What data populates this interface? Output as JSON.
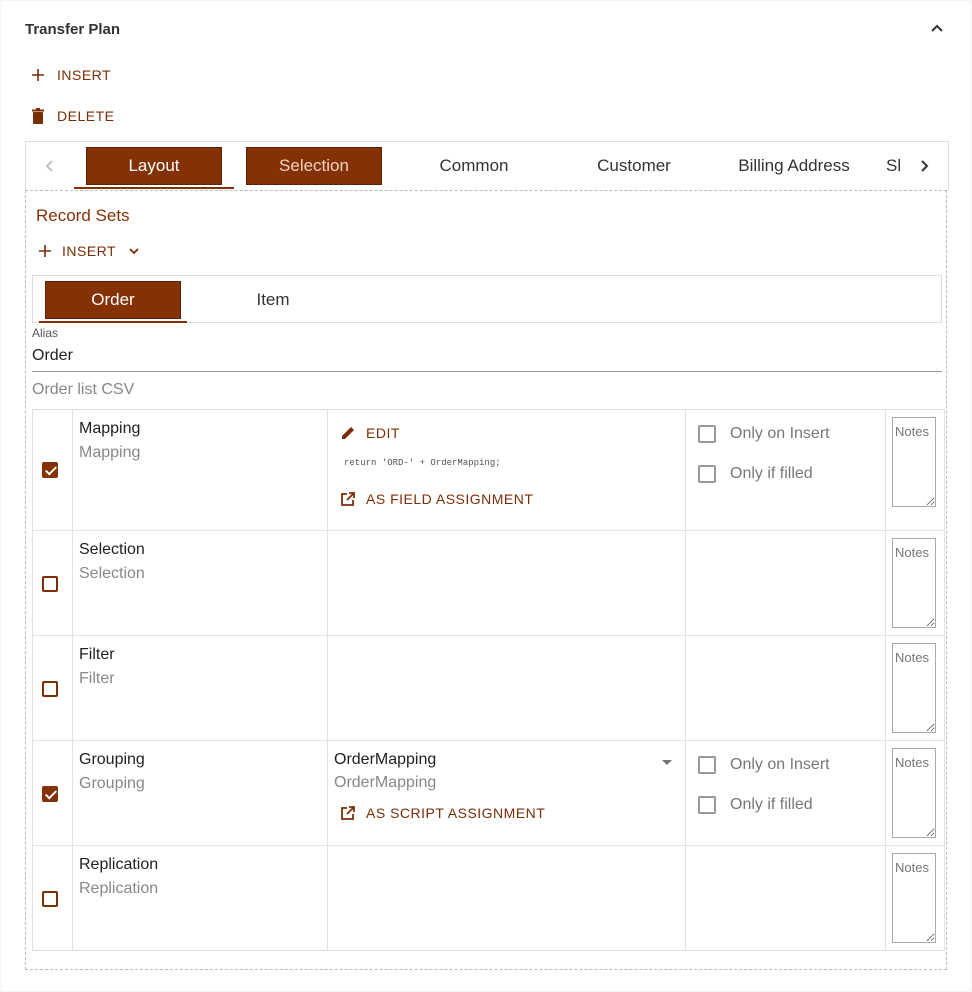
{
  "header": {
    "title": "Transfer Plan"
  },
  "actions": {
    "insert_label": "INSERT",
    "delete_label": "DELETE"
  },
  "main_tabs": [
    {
      "label": "Layout"
    },
    {
      "label": "Selection"
    },
    {
      "label": "Common"
    },
    {
      "label": "Customer"
    },
    {
      "label": "Billing Address"
    },
    {
      "label": "Sl"
    }
  ],
  "record_sets": {
    "title": "Record Sets",
    "insert_label": "INSERT",
    "tabs": [
      {
        "label": "Order"
      },
      {
        "label": "Item"
      }
    ],
    "alias": {
      "label": "Alias",
      "value": "Order"
    },
    "description": "Order list CSV"
  },
  "rows": [
    {
      "name": "Mapping",
      "sub": "Mapping",
      "checked": true,
      "edit_label": "EDIT",
      "code": "return 'ORD-' + OrderMapping;",
      "assign_label": "AS FIELD ASSIGNMENT",
      "opt_insert": "Only on Insert",
      "opt_filled": "Only if filled",
      "notes": "Notes"
    },
    {
      "name": "Selection",
      "sub": "Selection",
      "checked": false,
      "notes": "Notes"
    },
    {
      "name": "Filter",
      "sub": "Filter",
      "checked": false,
      "notes": "Notes"
    },
    {
      "name": "Grouping",
      "sub": "Grouping",
      "checked": true,
      "select_value": "OrderMapping",
      "select_sub": "OrderMapping",
      "assign_label": "AS SCRIPT ASSIGNMENT",
      "opt_insert": "Only on Insert",
      "opt_filled": "Only if filled",
      "notes": "Notes"
    },
    {
      "name": "Replication",
      "sub": "Replication",
      "checked": false,
      "notes": "Notes"
    }
  ],
  "colors": {
    "accent": "#843205"
  }
}
